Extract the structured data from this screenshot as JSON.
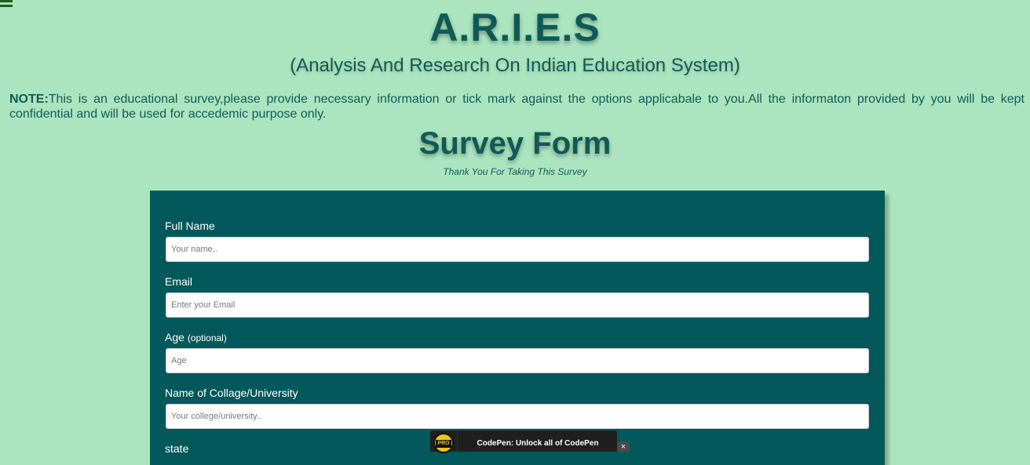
{
  "header": {
    "menu_icon": "hamburger-menu-icon",
    "title": "A.R.I.E.S",
    "subtitle": "(Analysis And Research On Indian Education System)"
  },
  "note": {
    "label": "NOTE:",
    "text": "This is an educational survey,please provide necessary information or tick mark against the options applicabale to you.All the informaton provided by you will be kept confidential and will be used for accedemic purpose only."
  },
  "survey": {
    "title": "Survey Form",
    "thanks": "Thank You For Taking This Survey"
  },
  "form": {
    "fields": [
      {
        "label": "Full Name",
        "placeholder": "Your name.."
      },
      {
        "label": "Email",
        "placeholder": "Enter your Email"
      },
      {
        "label": "Age",
        "optional": "(optional)",
        "placeholder": "Age"
      },
      {
        "label": "Name of Collage/University",
        "placeholder": "Your college/university.."
      },
      {
        "label": "state"
      }
    ]
  },
  "promo": {
    "badge": "PRO",
    "text": "CodePen: Unlock all of CodePen",
    "close": "×"
  },
  "colors": {
    "page_background": "#abe5bf",
    "heading": "#0f5a57",
    "form_background": "#02585a",
    "menu_icon": "#1b5e20"
  }
}
